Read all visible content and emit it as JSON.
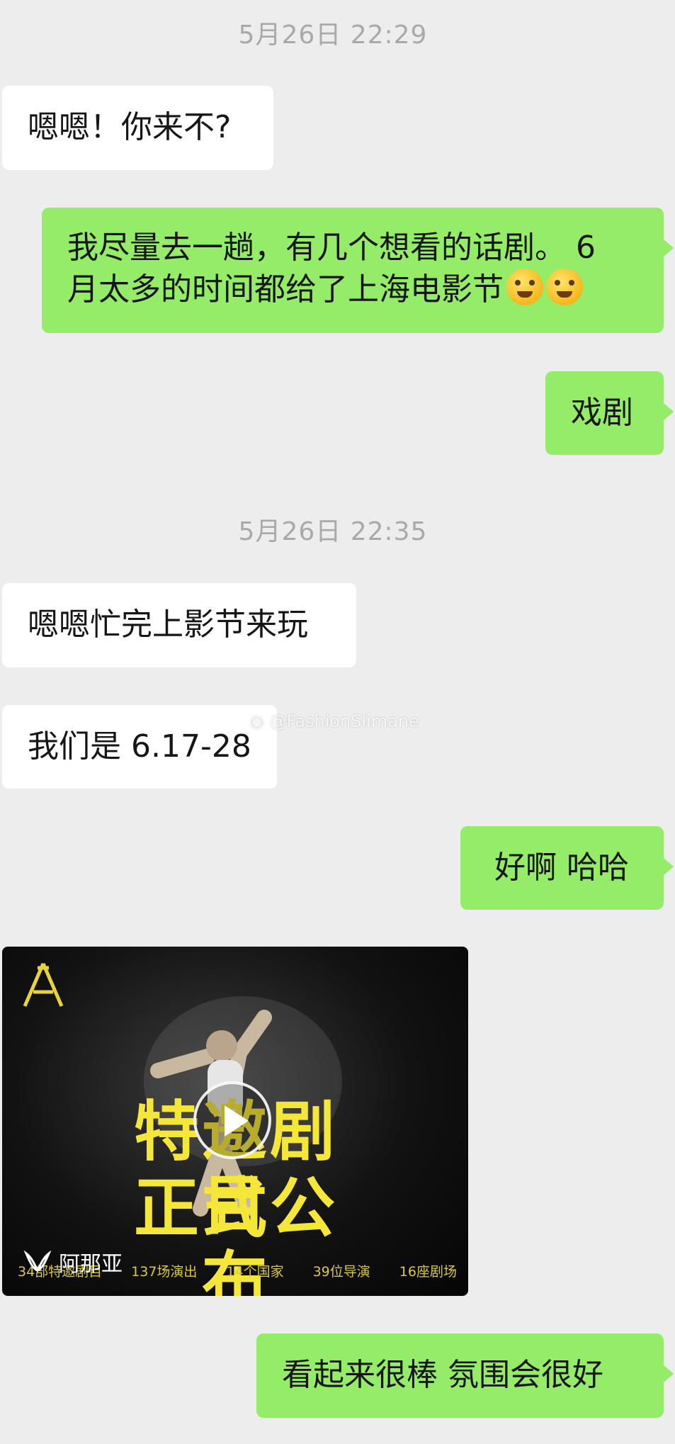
{
  "timestamps": [
    "5月26日 22:29",
    "5月26日 22:35"
  ],
  "messages": {
    "m1": "嗯嗯！你来不?",
    "m2_line1": "我尽量去一趟，有几个想看的话剧。 6",
    "m2_line2": "月太多的时间都给了上海电影节",
    "m3": "戏剧",
    "m4": "嗯嗯忙完上影节来玩",
    "m5": "我们是 6.17-28",
    "m6": "好啊 哈哈",
    "m7": "看起来很棒  氛围会很好"
  },
  "watermark": "@FashionSlimane",
  "video": {
    "title_line1": "特邀剧目",
    "title_line2": "正式公布",
    "stats": [
      "34部特邀剧目",
      "137场演出",
      "14个国家",
      "39位导演",
      "16座剧场"
    ],
    "source": "阿那亚",
    "emoji_names": [
      "crying-face-icon",
      "laughing-tears-icon"
    ]
  },
  "colors": {
    "background": "#ededed",
    "incoming_bubble": "#ffffff",
    "outgoing_bubble": "#95ec69",
    "timestamp": "#a9a9a9",
    "video_title": "#f5e63a"
  }
}
